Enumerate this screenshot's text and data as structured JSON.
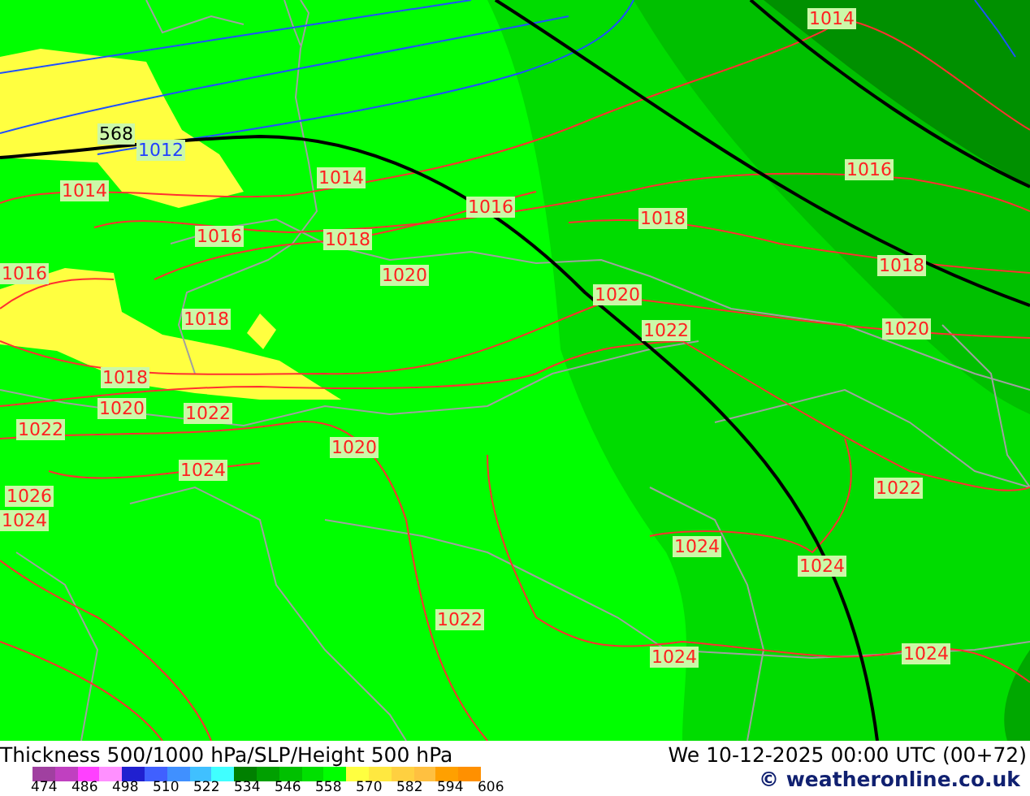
{
  "map": {
    "labels": [
      {
        "text": "1014",
        "kind": "isobar"
      },
      {
        "text": "568",
        "kind": "thickness"
      },
      {
        "text": "1012",
        "kind": "isobar-low"
      },
      {
        "text": "1016",
        "kind": "isobar"
      },
      {
        "text": "1014",
        "kind": "isobar"
      },
      {
        "text": "1014",
        "kind": "isobar"
      },
      {
        "text": "1016",
        "kind": "isobar"
      },
      {
        "text": "1018",
        "kind": "isobar"
      },
      {
        "text": "1016",
        "kind": "isobar"
      },
      {
        "text": "1018",
        "kind": "isobar"
      },
      {
        "text": "1016",
        "kind": "isobar"
      },
      {
        "text": "1018",
        "kind": "isobar"
      },
      {
        "text": "1020",
        "kind": "isobar"
      },
      {
        "text": "1020",
        "kind": "isobar"
      },
      {
        "text": "1018",
        "kind": "isobar"
      },
      {
        "text": "1022",
        "kind": "isobar"
      },
      {
        "text": "1020",
        "kind": "isobar"
      },
      {
        "text": "1018",
        "kind": "isobar"
      },
      {
        "text": "1020",
        "kind": "isobar"
      },
      {
        "text": "1022",
        "kind": "isobar"
      },
      {
        "text": "1022",
        "kind": "isobar"
      },
      {
        "text": "1020",
        "kind": "isobar"
      },
      {
        "text": "1024",
        "kind": "isobar"
      },
      {
        "text": "1022",
        "kind": "isobar"
      },
      {
        "text": "1026",
        "kind": "isobar"
      },
      {
        "text": "1024",
        "kind": "isobar"
      },
      {
        "text": "1024",
        "kind": "isobar"
      },
      {
        "text": "1024",
        "kind": "isobar"
      },
      {
        "text": "1022",
        "kind": "isobar"
      },
      {
        "text": "1024",
        "kind": "isobar"
      },
      {
        "text": "1024",
        "kind": "isobar"
      }
    ]
  },
  "title": "Thickness 500/1000 hPa/SLP/Height 500 hPa",
  "valid_time": "We 10-12-2025 00:00 UTC (00+72)",
  "copyright": "© weatheronline.co.uk",
  "legend": {
    "colors": [
      {
        "color": "#a040a0"
      },
      {
        "color": "#c040c0"
      },
      {
        "color": "#ff40ff"
      },
      {
        "color": "#ff90ff"
      },
      {
        "color": "#2020d0"
      },
      {
        "color": "#4060ff"
      },
      {
        "color": "#4090ff"
      },
      {
        "color": "#40c0ff"
      },
      {
        "color": "#40ffff"
      },
      {
        "color": "#008000"
      },
      {
        "color": "#00a000"
      },
      {
        "color": "#00c000"
      },
      {
        "color": "#00e000"
      },
      {
        "color": "#00ff00"
      },
      {
        "color": "#ffff40"
      },
      {
        "color": "#ffe840"
      },
      {
        "color": "#ffd040"
      },
      {
        "color": "#ffc040"
      },
      {
        "color": "#ffa000"
      },
      {
        "color": "#ff9000"
      }
    ],
    "ticks": [
      "474",
      "486",
      "498",
      "510",
      "522",
      "534",
      "546",
      "558",
      "570",
      "582",
      "594",
      "606"
    ]
  }
}
